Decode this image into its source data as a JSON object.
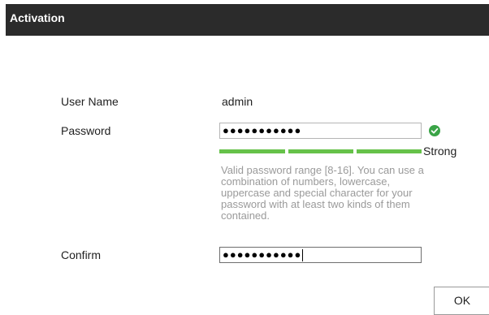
{
  "header": {
    "title": "Activation"
  },
  "form": {
    "username_label": "User Name",
    "username_value": "admin",
    "password_label": "Password",
    "password_value": "●●●●●●●●●●●",
    "confirm_label": "Confirm",
    "confirm_value": "●●●●●●●●●●●"
  },
  "strength": {
    "label": "Strong",
    "level": 3,
    "max_level": 3,
    "color": "#66c24a"
  },
  "hint": {
    "text": "Valid password range [8-16]. You can use a combination of numbers, lowercase, uppercase and special character for your password with at least two kinds of them contained."
  },
  "actions": {
    "ok_label": "OK"
  },
  "icons": {
    "password_valid": "check-circle-icon",
    "valid_color": "#3aa447"
  }
}
